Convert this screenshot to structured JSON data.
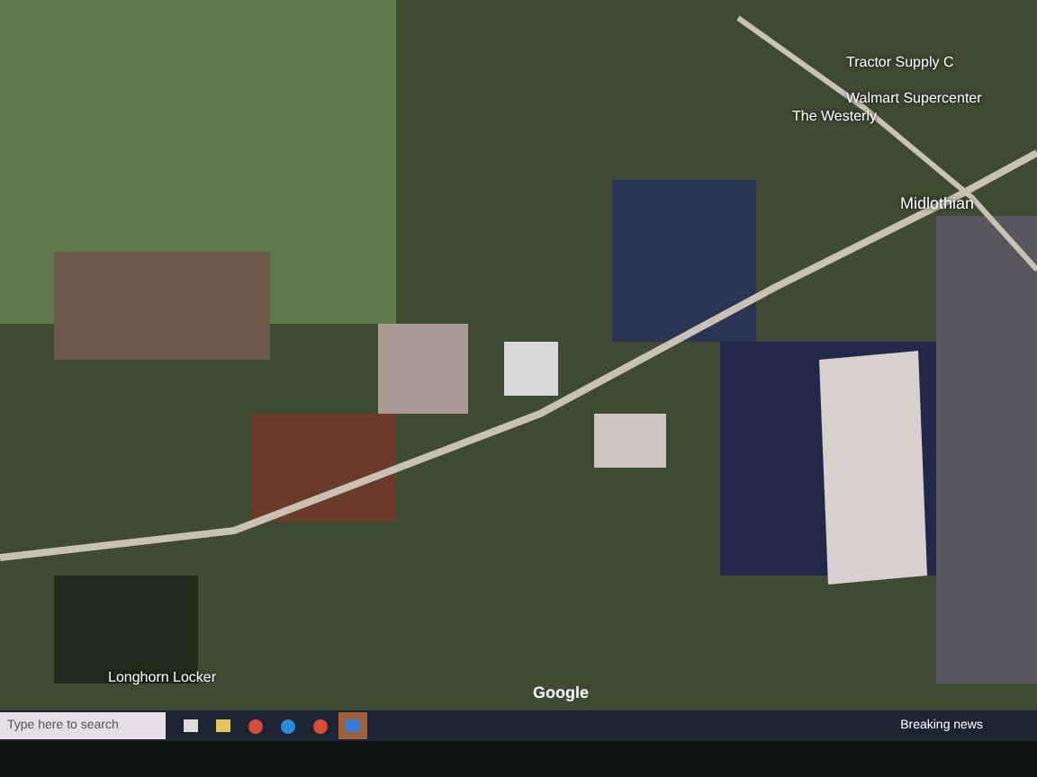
{
  "map": {
    "places": [
      {
        "label": "Tractor Supply C",
        "kind": "store"
      },
      {
        "label": "Walmart Supercenter",
        "kind": "store"
      },
      {
        "label": "The Westerly",
        "kind": "place"
      },
      {
        "label": "Midlothian",
        "kind": "town"
      },
      {
        "label": "Longhorn Locker",
        "kind": "store"
      }
    ],
    "attribution": "Google"
  },
  "taskbar": {
    "search": {
      "placeholder": "Type here to search"
    },
    "apps": [
      {
        "kind": "taskview"
      },
      {
        "kind": "folder"
      },
      {
        "kind": "chrome"
      },
      {
        "kind": "edge"
      },
      {
        "kind": "chrome"
      },
      {
        "kind": "tool"
      }
    ],
    "news": "Breaking news"
  }
}
